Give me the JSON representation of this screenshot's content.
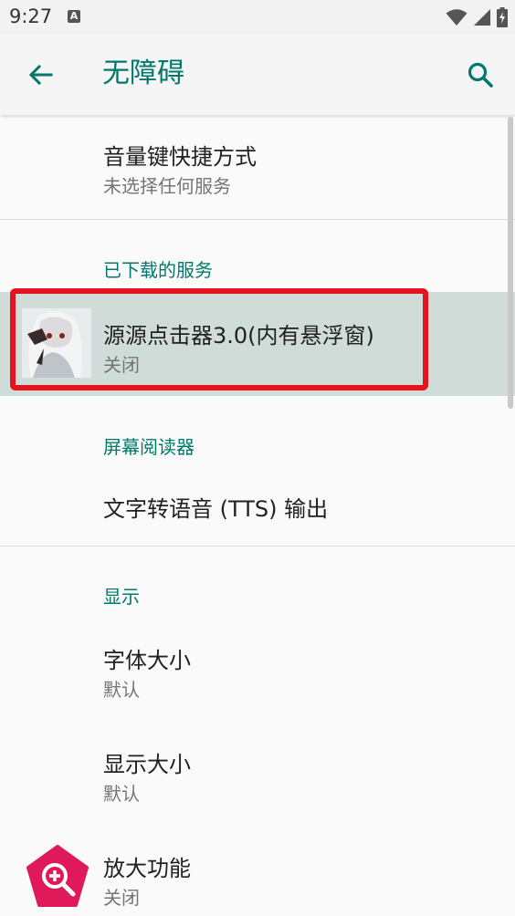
{
  "status_bar": {
    "time": "9:27",
    "notification_icon": "A"
  },
  "app_bar": {
    "title": "无障碍"
  },
  "items": {
    "volume_shortcut": {
      "title": "音量键快捷方式",
      "subtitle": "未选择任何服务"
    },
    "downloaded_header": "已下载的服务",
    "clicker_app": {
      "title": "源源点击器3.0(内有悬浮窗)",
      "subtitle": "关闭"
    },
    "screen_reader_header": "屏幕阅读器",
    "tts": {
      "title": "文字转语音 (TTS) 输出"
    },
    "display_header": "显示",
    "font_size": {
      "title": "字体大小",
      "subtitle": "默认"
    },
    "display_size": {
      "title": "显示大小",
      "subtitle": "默认"
    },
    "magnification": {
      "title": "放大功能",
      "subtitle": "关闭"
    }
  },
  "colors": {
    "accent": "#00796b",
    "highlight": "#cfdcd8",
    "annotation_box": "#e3141f",
    "magnify_badge": "#e0195a"
  },
  "icons": [
    "back-arrow-icon",
    "search-icon",
    "wifi-icon",
    "cell-signal-icon",
    "battery-icon",
    "magnification-icon",
    "app-avatar-image"
  ]
}
